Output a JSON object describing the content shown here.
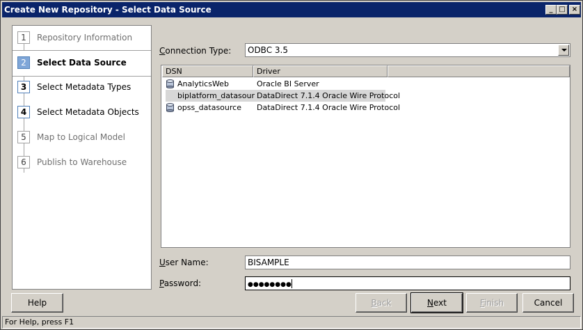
{
  "window": {
    "title": "Create New Repository - Select Data Source"
  },
  "steps": [
    {
      "num": "1",
      "label": "Repository Information",
      "state": "past"
    },
    {
      "num": "2",
      "label": "Select Data Source",
      "state": "active"
    },
    {
      "num": "3",
      "label": "Select Metadata Types",
      "state": "next"
    },
    {
      "num": "4",
      "label": "Select Metadata Objects",
      "state": "next"
    },
    {
      "num": "5",
      "label": "Map to Logical Model",
      "state": "future"
    },
    {
      "num": "6",
      "label": "Publish to Warehouse",
      "state": "future"
    }
  ],
  "connection": {
    "label": "Connection Type:",
    "value": "ODBC 3.5"
  },
  "dsn_table": {
    "columns": [
      "DSN",
      "Driver"
    ],
    "rows": [
      {
        "dsn": "AnalyticsWeb",
        "driver": "Oracle BI Server"
      },
      {
        "dsn": "biplatform_datasource",
        "driver": "DataDirect 7.1.4 Oracle Wire Protocol",
        "selected": true
      },
      {
        "dsn": "opss_datasource",
        "driver": "DataDirect 7.1.4 Oracle Wire Protocol"
      }
    ]
  },
  "credentials": {
    "user_label": "User Name:",
    "user_value": "BISAMPLE",
    "password_label": "Password:",
    "password_value": "●●●●●●●●"
  },
  "buttons": {
    "help": "Help",
    "back": "Back",
    "next": "Next",
    "finish": "Finish",
    "cancel": "Cancel"
  },
  "status": {
    "text": "For Help, press F1"
  },
  "colors": {
    "titlebar": "#0a246a",
    "active_step": "#7fa6d8",
    "face": "#d4d0c8"
  }
}
